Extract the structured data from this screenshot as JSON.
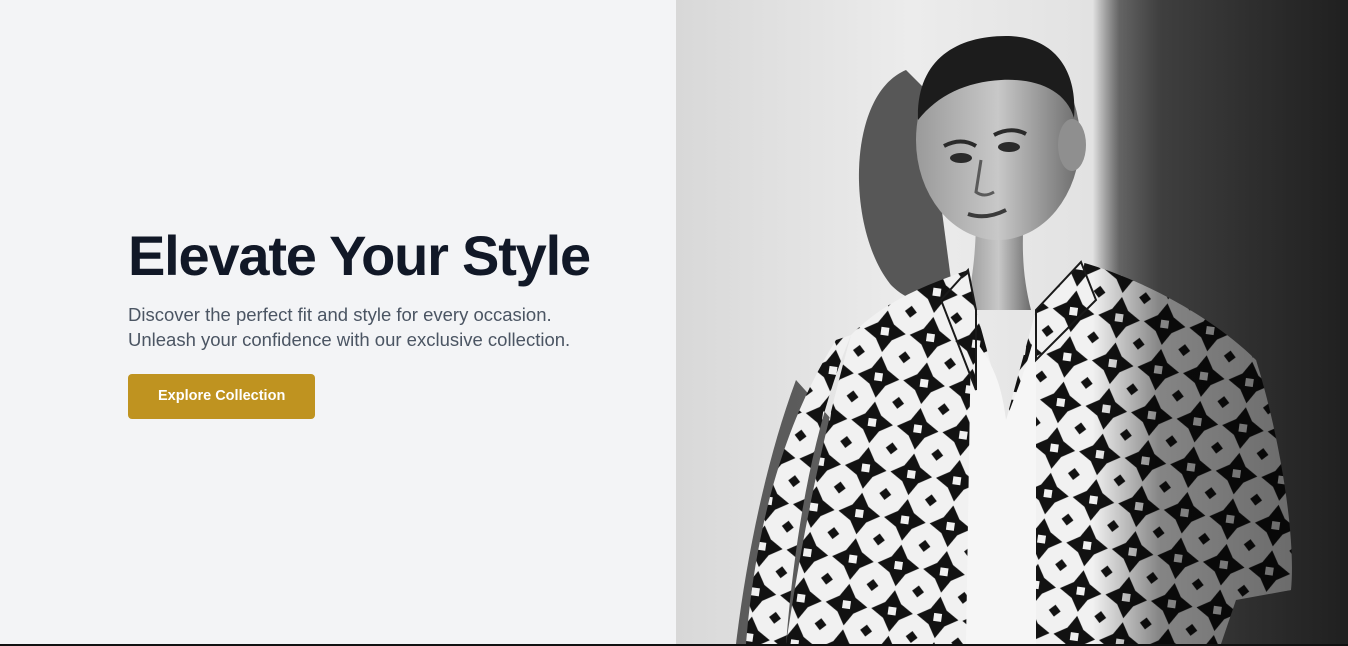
{
  "hero": {
    "title": "Elevate Your Style",
    "subtitle_line1": "Discover the perfect fit and style for every occasion.",
    "subtitle_line2": "Unleash your confidence with our exclusive collection.",
    "cta_label": "Explore Collection",
    "cta_color": "#bf9320",
    "background_color": "#f3f4f6",
    "image": {
      "icon": "model-photo-icon"
    }
  }
}
